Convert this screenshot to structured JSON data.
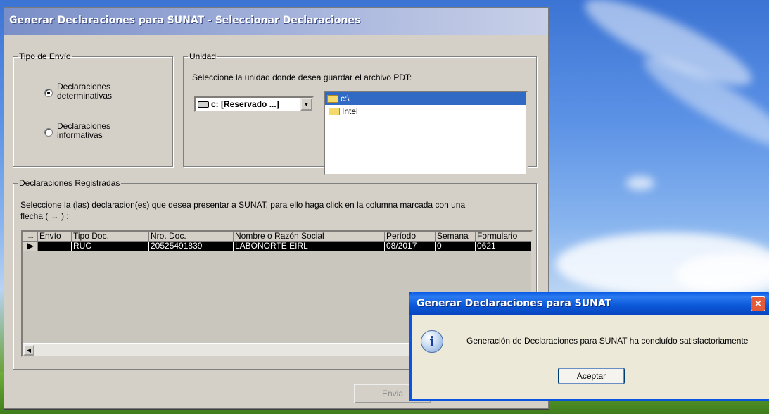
{
  "window": {
    "title": "Generar Declaraciones para SUNAT - Seleccionar Declaraciones"
  },
  "tipo_envio": {
    "legend": "Tipo de Envío",
    "options": [
      {
        "line1": "Declaraciones",
        "line2": "determinativas",
        "checked": true
      },
      {
        "line1": "Declaraciones",
        "line2": "informativas",
        "checked": false
      }
    ]
  },
  "unidad": {
    "legend": "Unidad",
    "instruction": "Seleccione la unidad donde desea guardar el archivo PDT:",
    "drive_value": "c: [Reservado ...]",
    "folders": [
      "c:\\",
      "Intel"
    ]
  },
  "declaraciones": {
    "legend": "Declaraciones Registradas",
    "instruction_line1": "Seleccione la (las) declaracion(es) que desea presentar a SUNAT, para ello haga click en la columna marcada con una",
    "instruction_line2": "flecha  ( → ) :",
    "columns": {
      "arrow": "→",
      "envio": "Envío",
      "tipo": "Tipo Doc.",
      "nro": "Nro. Doc.",
      "nombre": "Nombre o Razón Social",
      "periodo": "Período",
      "semana": "Semana",
      "formulario": "Formulario"
    },
    "row": {
      "envio": "",
      "tipo": "RUC",
      "nro": "20525491839",
      "nombre": "LABONORTE EIRL",
      "periodo": "08/2017",
      "semana": "0",
      "formulario": "0621"
    }
  },
  "buttons": {
    "enviar": "Envia"
  },
  "dialog": {
    "title": "Generar Declaraciones para SUNAT",
    "message": "Generación de Declaraciones para SUNAT ha concluído satisfactoriamente",
    "ok": "Aceptar",
    "close": "✕"
  }
}
